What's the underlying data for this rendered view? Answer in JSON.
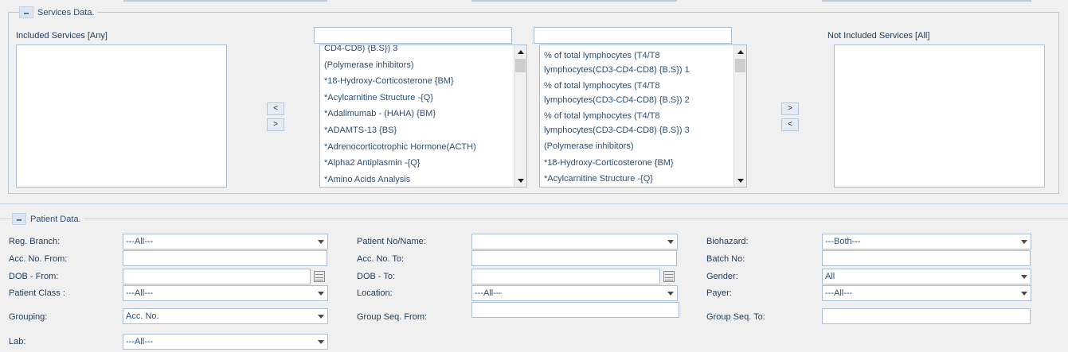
{
  "services": {
    "legend": "Services Data.",
    "toggle": "–",
    "included_label": "Included Services [Any]",
    "not_included_label": "Not Included Services [All]",
    "move_left": "<",
    "move_right": ">",
    "search_left_value": "",
    "search_right_value": "",
    "left_list": [
      "CD4-CD8) {B.S}) 3",
      "(Polymerase inhibitors)",
      "*18-Hydroxy-Corticosterone {BM}",
      "*Acylcarnitine Structure -{Q}",
      "*Adalimumab - (HAHA) {BM}",
      "*ADAMTS-13 {BS}",
      "*Adrenocorticotrophic Hormone(ACTH)",
      "*Alpha2 Antiplasmin -{Q}",
      "*Amino Acids Analysis"
    ],
    "right_list": [
      "% of total lymphocytes (T4/T8 lymphocytes(CD3-CD4-CD8) {B.S}) 1",
      "% of total lymphocytes (T4/T8 lymphocytes(CD3-CD4-CD8) {B.S}) 2",
      "% of total lymphocytes (T4/T8 lymphocytes(CD3-CD4-CD8) {B.S}) 3",
      "(Polymerase inhibitors)",
      "*18-Hydroxy-Corticosterone {BM}",
      "*Acylcarnitine Structure -{Q}"
    ]
  },
  "patient": {
    "legend": "Patient Data.",
    "toggle": "–",
    "reg_branch_label": "Reg. Branch:",
    "reg_branch_value": "---All---",
    "patient_no_label": "Patient No/Name:",
    "patient_no_value": "",
    "biohazard_label": "Biohazard:",
    "biohazard_value": "---Both---",
    "acc_from_label": "Acc. No. From:",
    "acc_from_value": "",
    "acc_to_label": "Acc. No. To:",
    "acc_to_value": "",
    "batch_label": "Batch No:",
    "batch_value": "",
    "dob_from_label": "DOB - From:",
    "dob_from_value": "",
    "dob_to_label": "DOB - To:",
    "dob_to_value": "",
    "gender_label": "Gender:",
    "gender_value": "All",
    "patient_class_label": "Patient Class :",
    "patient_class_value": "---All---",
    "location_label": "Location:",
    "location_value": "---All---",
    "payer_label": "Payer:",
    "payer_value": "---All---",
    "grouping_label": "Grouping:",
    "grouping_value": "Acc. No.",
    "group_seq_from_label": "Group Seq. From:",
    "group_seq_from_value": "",
    "group_seq_to_label": "Group Seq. To:",
    "group_seq_to_value": "",
    "lab_label": "Lab:",
    "lab_value": "---All---"
  }
}
